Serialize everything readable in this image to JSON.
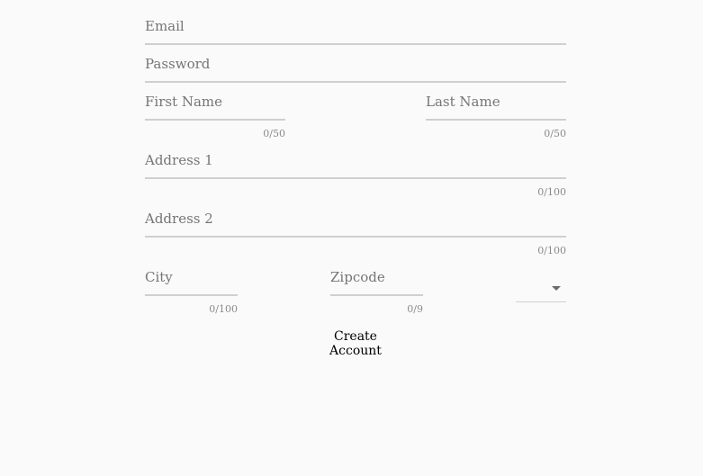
{
  "form": {
    "email": {
      "label": "Email",
      "value": ""
    },
    "password": {
      "label": "Password",
      "value": ""
    },
    "first_name": {
      "label": "First Name",
      "value": "",
      "counter": "0/50"
    },
    "last_name": {
      "label": "Last Name",
      "value": "",
      "counter": "0/50"
    },
    "address1": {
      "label": "Address 1",
      "value": "",
      "counter": "0/100"
    },
    "address2": {
      "label": "Address 2",
      "value": "",
      "counter": "0/100"
    },
    "city": {
      "label": "City",
      "value": "",
      "counter": "0/100"
    },
    "zipcode": {
      "label": "Zipcode",
      "value": "",
      "counter": "0/9"
    },
    "state": {
      "selected": ""
    },
    "submit_label": "Create Account"
  }
}
